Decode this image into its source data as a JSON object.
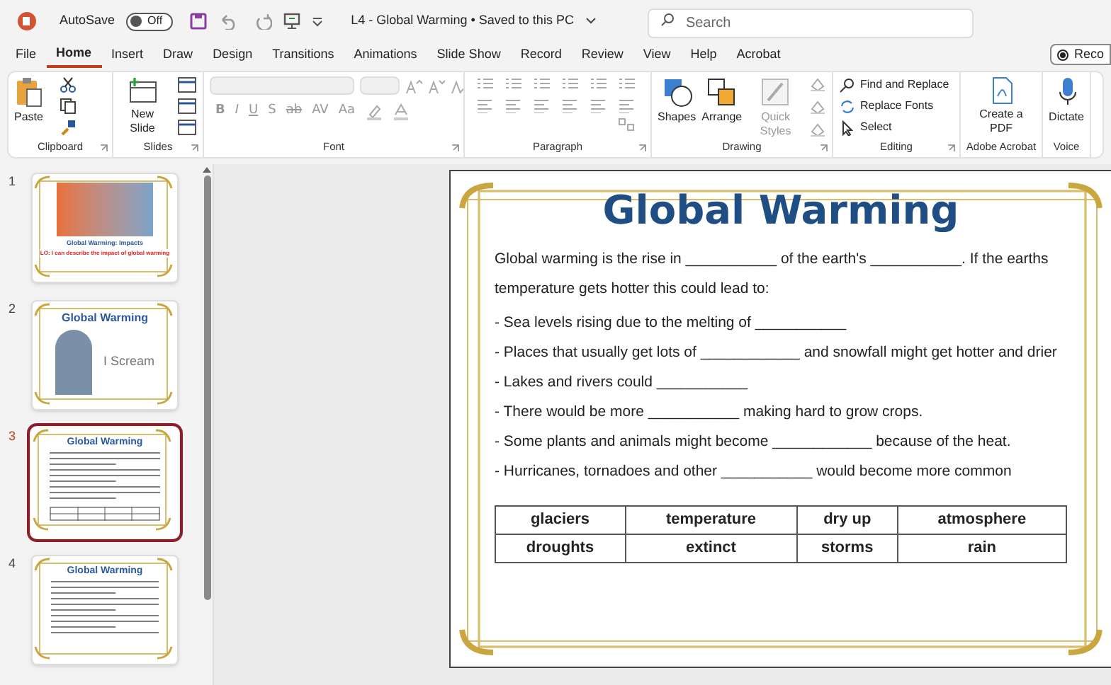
{
  "title_bar": {
    "autosave_label": "AutoSave",
    "autosave_toggle": {
      "on": false,
      "label": "Off"
    },
    "document_title": "L4 - Global Warming • Saved to this PC",
    "search": {
      "placeholder": "Search"
    }
  },
  "menu_tabs": [
    {
      "label": "File",
      "selected": false
    },
    {
      "label": "Home",
      "selected": true
    },
    {
      "label": "Insert",
      "selected": false
    },
    {
      "label": "Draw",
      "selected": false
    },
    {
      "label": "Design",
      "selected": false
    },
    {
      "label": "Transitions",
      "selected": false
    },
    {
      "label": "Animations",
      "selected": false
    },
    {
      "label": "Slide Show",
      "selected": false
    },
    {
      "label": "Record",
      "selected": false
    },
    {
      "label": "Review",
      "selected": false
    },
    {
      "label": "View",
      "selected": false
    },
    {
      "label": "Help",
      "selected": false
    },
    {
      "label": "Acrobat",
      "selected": false
    }
  ],
  "record_button": "Reco",
  "ribbon": {
    "clipboard": {
      "paste": "Paste",
      "group_label": "Clipboard"
    },
    "slides": {
      "new_slide": "New Slide",
      "group_label": "Slides"
    },
    "font": {
      "format_buttons": [
        "B",
        "I",
        "U",
        "S",
        "ab",
        "AV",
        "Aa"
      ],
      "group_label": "Font"
    },
    "paragraph": {
      "group_label": "Paragraph"
    },
    "drawing": {
      "buttons": [
        {
          "label": "Shapes",
          "disabled": false
        },
        {
          "label": "Arrange",
          "disabled": false
        },
        {
          "label": "Quick Styles",
          "disabled": true
        }
      ],
      "group_label": "Drawing"
    },
    "editing": {
      "buttons": [
        "Find and Replace",
        "Replace Fonts",
        "Select"
      ],
      "group_label": "Editing"
    },
    "acrobat": {
      "button": "Create a PDF",
      "group_label": "Adobe Acrobat"
    },
    "voice": {
      "button": "Dictate",
      "group_label": "Voice"
    }
  },
  "thumbnails": [
    {
      "number": "1",
      "selected": false,
      "kind": "cover",
      "title": "Global Warming: Impacts",
      "subtitle": "LO: I can describe the impact of global warming"
    },
    {
      "number": "2",
      "selected": false,
      "kind": "image",
      "title": "Global Warming",
      "caption": "I Scream"
    },
    {
      "number": "3",
      "selected": true,
      "kind": "worksheet",
      "title": "Global Warming"
    },
    {
      "number": "4",
      "selected": false,
      "kind": "task",
      "title": "Global Warming"
    }
  ],
  "slide": {
    "title": "Global Warming",
    "lines": [
      "Global warming is the rise in ___________ of the earth's ___________. If the earths temperature gets hotter this could lead to:",
      "- Sea levels rising due to the melting of ___________",
      "- Places that usually get lots of ____________ and snowfall might get hotter and drier",
      "- Lakes and rivers could ___________",
      "- There would be more ___________ making hard to grow crops.",
      "- Some plants and animals might become ____________ because of the heat.",
      "- Hurricanes, tornadoes and other ___________ would become more common"
    ],
    "word_bank": [
      [
        "glaciers",
        "temperature",
        "dry up",
        "atmosphere"
      ],
      [
        "droughts",
        "extinct",
        "storms",
        "rain"
      ]
    ]
  }
}
